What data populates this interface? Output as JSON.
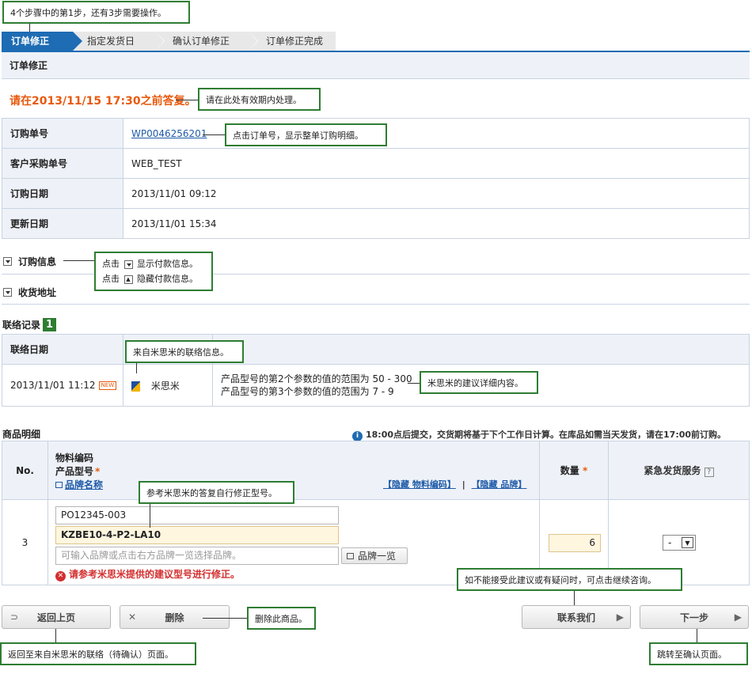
{
  "callouts": {
    "steps_info": "4个步骤中的第1步，还有3步需要操作。",
    "deadline_info": "请在此处有效期内处理。",
    "order_link_info": "点击订单号，显示整单订购明细。",
    "toggle_show": "点击",
    "toggle_show_suffix": "显示付款信息。",
    "toggle_hide": "点击",
    "toggle_hide_suffix": "隐藏付款信息。",
    "contact_source": "来自米思米的联络信息。",
    "suggest_detail": "米思米的建议详细内容。",
    "model_fix": "参考米思米的答复自行修正型号。",
    "inquiry": "如不能接受此建议或有疑问时，可点击继续咨询。",
    "delete_info": "删除此商品。",
    "back_info": "返回至来自米思米的联络（待确认）页面。",
    "next_info": "跳转至确认页面。"
  },
  "steps": [
    {
      "label": "订单修正",
      "active": true
    },
    {
      "label": "指定发货日",
      "active": false
    },
    {
      "label": "确认订单修正",
      "active": false
    },
    {
      "label": "订单修正完成",
      "active": false
    }
  ],
  "page_title": "订单修正",
  "deadline": "请在2013/11/15 17:30之前答复。",
  "order_info": {
    "rows": [
      {
        "label": "订购单号",
        "value": "WP0046256201"
      },
      {
        "label": "客户采购单号",
        "value": "WEB_TEST"
      },
      {
        "label": "订购日期",
        "value": "2013/11/01 09:12"
      },
      {
        "label": "更新日期",
        "value": "2013/11/01 15:34"
      }
    ]
  },
  "sections": {
    "purchase_info": "订购信息",
    "ship_address": "收货地址",
    "contact_log": "联络记录",
    "contact_log_badge": "1",
    "product_detail": "商品明细"
  },
  "contact": {
    "header_date": "联络日期",
    "date": "2013/11/01 11:12",
    "new_badge": "NEW",
    "sender": "米思米",
    "message_line1": "产品型号的第2个参数的值的范围为 50 - 300",
    "message_line2": "产品型号的第3个参数的值的范围为 7 - 9"
  },
  "notice": "18:00点后提交，交货期将基于下个工作日计算。在库品如需当天发货，请在17:00前订购。",
  "products": {
    "col_no": "No.",
    "col_item_code": "物料编码",
    "col_model": "产品型号",
    "col_brand": "品牌名称",
    "required_mark": "*",
    "hide_item_code": "【隐藏 物料编码】",
    "divider": "|",
    "hide_brand": "【隐藏 品牌】",
    "col_qty": "数量",
    "col_urgent": "紧急发货服务",
    "help": "?",
    "row": {
      "no": "3",
      "item_code": "PO12345-003",
      "model": "KZBE10-4-P2-LA10",
      "brand_placeholder": "可输入品牌或点击右方品牌一览选择品牌。",
      "brand_list_button": "品牌一览",
      "error": "请参考米思米提供的建议型号进行修正。",
      "qty": "6",
      "urgent": "-"
    }
  },
  "buttons": {
    "back": "返回上页",
    "delete": "删除",
    "contact_us": "联系我们",
    "next": "下一步"
  }
}
